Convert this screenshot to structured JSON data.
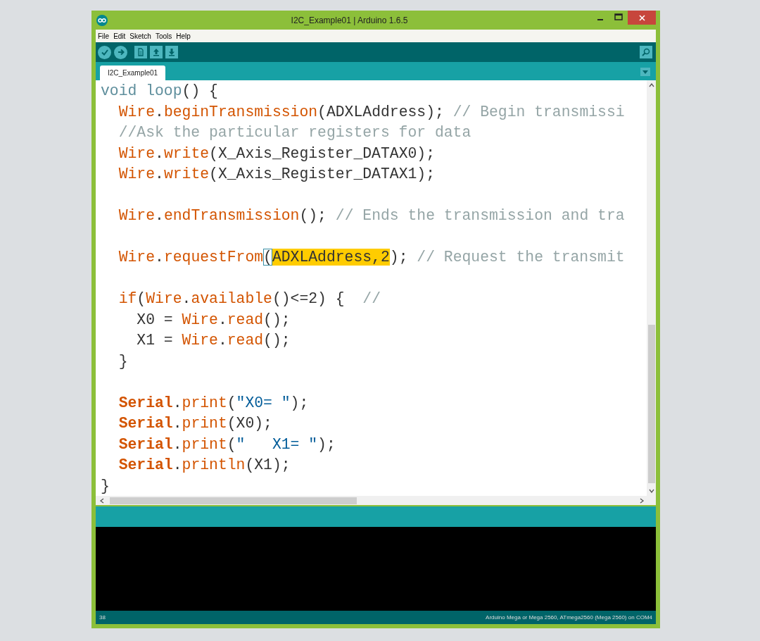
{
  "window": {
    "title": "I2C_Example01 | Arduino 1.6.5"
  },
  "menu": [
    "File",
    "Edit",
    "Sketch",
    "Tools",
    "Help"
  ],
  "toolbar": [
    {
      "kind": "verify"
    },
    {
      "kind": "upload"
    },
    {
      "kind": "new"
    },
    {
      "kind": "open"
    },
    {
      "kind": "save"
    }
  ],
  "tabs": [
    {
      "label": "I2C_Example01",
      "selected": true
    }
  ],
  "code": [
    {
      "kind": "code",
      "tokens": [
        {
          "text": "void",
          "kind": "type"
        },
        {
          "text": " loop",
          "kind": "type"
        },
        {
          "text": "() {",
          "kind": "plain"
        }
      ]
    },
    {
      "kind": "code",
      "tokens": [
        {
          "text": "  Wire",
          "kind": "kw"
        },
        {
          "text": ".",
          "kind": "plain"
        },
        {
          "text": "beginTransmission",
          "kind": "kw"
        },
        {
          "text": "(ADXLAddress); ",
          "kind": "plain"
        },
        {
          "text": "// Begin transmissi",
          "kind": "comment"
        }
      ]
    },
    {
      "kind": "code",
      "tokens": [
        {
          "text": "  //Ask the particular registers for data",
          "kind": "comment"
        }
      ]
    },
    {
      "kind": "code",
      "tokens": [
        {
          "text": "  Wire",
          "kind": "kw"
        },
        {
          "text": ".",
          "kind": "plain"
        },
        {
          "text": "write",
          "kind": "kw"
        },
        {
          "text": "(X_Axis_Register_DATAX0);",
          "kind": "plain"
        }
      ]
    },
    {
      "kind": "code",
      "tokens": [
        {
          "text": "  Wire",
          "kind": "kw"
        },
        {
          "text": ".",
          "kind": "plain"
        },
        {
          "text": "write",
          "kind": "kw"
        },
        {
          "text": "(X_Axis_Register_DATAX1);",
          "kind": "plain"
        }
      ]
    },
    {
      "kind": "blank"
    },
    {
      "kind": "code",
      "tokens": [
        {
          "text": "  Wire",
          "kind": "kw"
        },
        {
          "text": ".",
          "kind": "plain"
        },
        {
          "text": "endTransmission",
          "kind": "kw"
        },
        {
          "text": "(); ",
          "kind": "plain"
        },
        {
          "text": "// Ends the transmission and tra",
          "kind": "comment"
        }
      ]
    },
    {
      "kind": "blank"
    },
    {
      "kind": "code",
      "tokens": [
        {
          "text": "  Wire",
          "kind": "kw"
        },
        {
          "text": ".",
          "kind": "plain"
        },
        {
          "text": "requestFrom",
          "kind": "kw"
        },
        {
          "text": "(",
          "kind": "plain",
          "bracket_match": true
        },
        {
          "text": "ADXLAddress,2",
          "kind": "plain",
          "selected": true
        },
        {
          "text": "); ",
          "kind": "plain"
        },
        {
          "text": "// Request the transmit",
          "kind": "comment"
        }
      ]
    },
    {
      "kind": "blank"
    },
    {
      "kind": "code",
      "tokens": [
        {
          "text": "  if",
          "kind": "kw"
        },
        {
          "text": "(",
          "kind": "plain"
        },
        {
          "text": "Wire",
          "kind": "kw"
        },
        {
          "text": ".",
          "kind": "plain"
        },
        {
          "text": "available",
          "kind": "kw"
        },
        {
          "text": "()<=2) {  ",
          "kind": "plain"
        },
        {
          "text": "//",
          "kind": "comment"
        }
      ]
    },
    {
      "kind": "code",
      "tokens": [
        {
          "text": "    X0 = ",
          "kind": "plain"
        },
        {
          "text": "Wire",
          "kind": "kw"
        },
        {
          "text": ".",
          "kind": "plain"
        },
        {
          "text": "read",
          "kind": "kw"
        },
        {
          "text": "();",
          "kind": "plain"
        }
      ]
    },
    {
      "kind": "code",
      "tokens": [
        {
          "text": "    X1 = ",
          "kind": "plain"
        },
        {
          "text": "Wire",
          "kind": "kw"
        },
        {
          "text": ".",
          "kind": "plain"
        },
        {
          "text": "read",
          "kind": "kw"
        },
        {
          "text": "();",
          "kind": "plain"
        }
      ]
    },
    {
      "kind": "code",
      "tokens": [
        {
          "text": "  }",
          "kind": "plain"
        }
      ]
    },
    {
      "kind": "blank"
    },
    {
      "kind": "code",
      "tokens": [
        {
          "text": "  Serial",
          "kind": "class"
        },
        {
          "text": ".",
          "kind": "plain"
        },
        {
          "text": "print",
          "kind": "kw"
        },
        {
          "text": "(",
          "kind": "plain"
        },
        {
          "text": "\"X0= \"",
          "kind": "string"
        },
        {
          "text": ");",
          "kind": "plain"
        }
      ]
    },
    {
      "kind": "code",
      "tokens": [
        {
          "text": "  Serial",
          "kind": "class"
        },
        {
          "text": ".",
          "kind": "plain"
        },
        {
          "text": "print",
          "kind": "kw"
        },
        {
          "text": "(X0);",
          "kind": "plain"
        }
      ]
    },
    {
      "kind": "code",
      "tokens": [
        {
          "text": "  Serial",
          "kind": "class"
        },
        {
          "text": ".",
          "kind": "plain"
        },
        {
          "text": "print",
          "kind": "kw"
        },
        {
          "text": "(",
          "kind": "plain"
        },
        {
          "text": "\"   X1= \"",
          "kind": "string"
        },
        {
          "text": ");",
          "kind": "plain"
        }
      ]
    },
    {
      "kind": "code",
      "tokens": [
        {
          "text": "  Serial",
          "kind": "class"
        },
        {
          "text": ".",
          "kind": "plain"
        },
        {
          "text": "println",
          "kind": "kw"
        },
        {
          "text": "(X1);",
          "kind": "plain"
        }
      ]
    },
    {
      "kind": "code",
      "tokens": [
        {
          "text": "}",
          "kind": "plain"
        }
      ]
    }
  ],
  "status_bar": {
    "line": "38",
    "board": "Arduino Mega or Mega 2560, ATmega2560 (Mega 2560) on COM4"
  }
}
